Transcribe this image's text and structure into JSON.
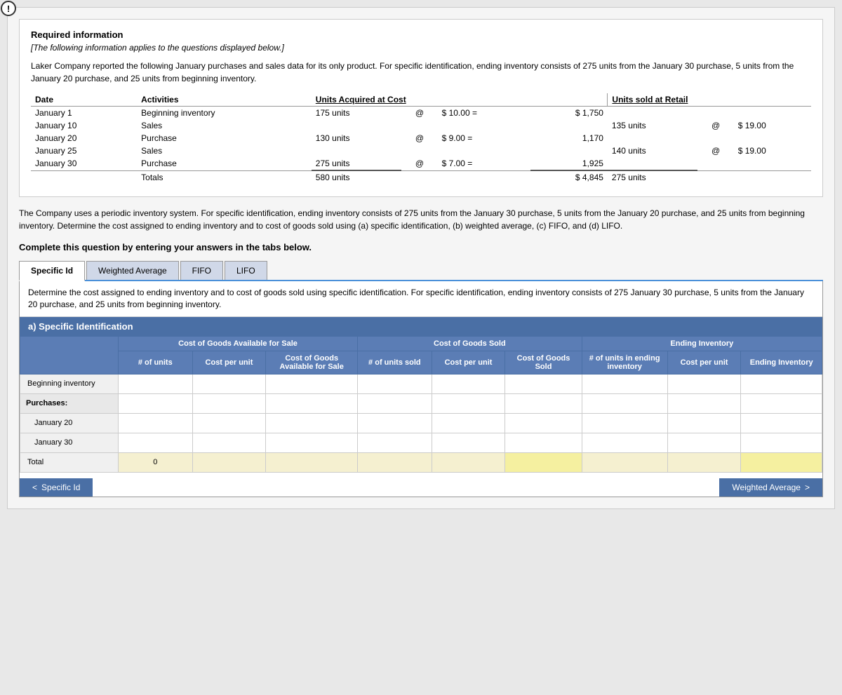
{
  "warning": "!",
  "required_info": {
    "title": "Required information",
    "subtitle": "[The following information applies to the questions displayed below.]",
    "description": "Laker Company reported the following January purchases and sales data for its only product. For specific identification, ending inventory consists of 275 units from the January 30 purchase, 5 units from the January 20 purchase, and 25 units from beginning inventory."
  },
  "data_table": {
    "headers": [
      "Date",
      "Activities",
      "Units Acquired at Cost",
      "",
      "",
      "Units sold at Retail"
    ],
    "rows": [
      {
        "date": "January 1",
        "activity": "Beginning inventory",
        "units_acq": "175 units",
        "at_symbol": "@",
        "cost": "$ 10.00 =",
        "total": "$ 1,750",
        "units_sold": "",
        "sold_at": "",
        "retail": ""
      },
      {
        "date": "January 10",
        "activity": "Sales",
        "units_acq": "",
        "at_symbol": "",
        "cost": "",
        "total": "",
        "units_sold": "135 units",
        "sold_at": "@",
        "retail": "$ 19.00"
      },
      {
        "date": "January 20",
        "activity": "Purchase",
        "units_acq": "130 units",
        "at_symbol": "@",
        "cost": "$ 9.00 =",
        "total": "1,170",
        "units_sold": "",
        "sold_at": "",
        "retail": ""
      },
      {
        "date": "January 25",
        "activity": "Sales",
        "units_acq": "",
        "at_symbol": "",
        "cost": "",
        "total": "",
        "units_sold": "140 units",
        "sold_at": "@",
        "retail": "$ 19.00"
      },
      {
        "date": "January 30",
        "activity": "Purchase",
        "units_acq": "275 units",
        "at_symbol": "@",
        "cost": "$ 7.00 =",
        "total": "1,925",
        "units_sold": "",
        "sold_at": "",
        "retail": ""
      }
    ],
    "totals": {
      "label": "Totals",
      "units_acq": "580 units",
      "total_cost": "$ 4,845",
      "units_sold": "275 units"
    }
  },
  "problem_text": "The Company uses a periodic inventory system. For specific identification, ending inventory consists of 275 units from the January 30 purchase, 5 units from the January 20 purchase, and 25 units from beginning inventory. Determine the cost assigned to ending inventory and to cost of goods sold using (a) specific identification, (b) weighted average, (c) FIFO, and (d) LIFO.",
  "instruction": "Complete this question by entering your answers in the tabs below.",
  "tabs": [
    {
      "id": "specific-id",
      "label": "Specific Id",
      "active": true
    },
    {
      "id": "weighted-average",
      "label": "Weighted Average",
      "active": false
    },
    {
      "id": "fifo",
      "label": "FIFO",
      "active": false
    },
    {
      "id": "lifo",
      "label": "LIFO",
      "active": false
    }
  ],
  "tab_description": "Determine the cost assigned to ending inventory and to cost of goods sold using specific identification. For specific identification, ending inventory consists of 275 January 30 purchase, 5 units from the January 20 purchase, and 25 units from beginning inventory.",
  "section_a": {
    "title": "a) Specific Identification",
    "col_group1": "Cost of Goods Available for Sale",
    "col_group2": "Cost of Goods Sold",
    "col_group3": "Ending Inventory",
    "columns": [
      "# of units",
      "Cost per unit",
      "Cost of Goods Available for Sale",
      "# of units sold",
      "Cost per unit",
      "Cost of Goods Sold",
      "# of units in ending inventory",
      "Cost per unit",
      "Ending Inventory"
    ],
    "rows": [
      {
        "label": "Beginning inventory",
        "type": "row"
      },
      {
        "label": "Purchases:",
        "type": "section"
      },
      {
        "label": "January 20",
        "type": "subrow"
      },
      {
        "label": "January 30",
        "type": "subrow"
      },
      {
        "label": "Total",
        "type": "total",
        "col2_value": "0"
      }
    ]
  },
  "nav": {
    "prev_label": "Specific Id",
    "next_label": "Weighted Average"
  }
}
